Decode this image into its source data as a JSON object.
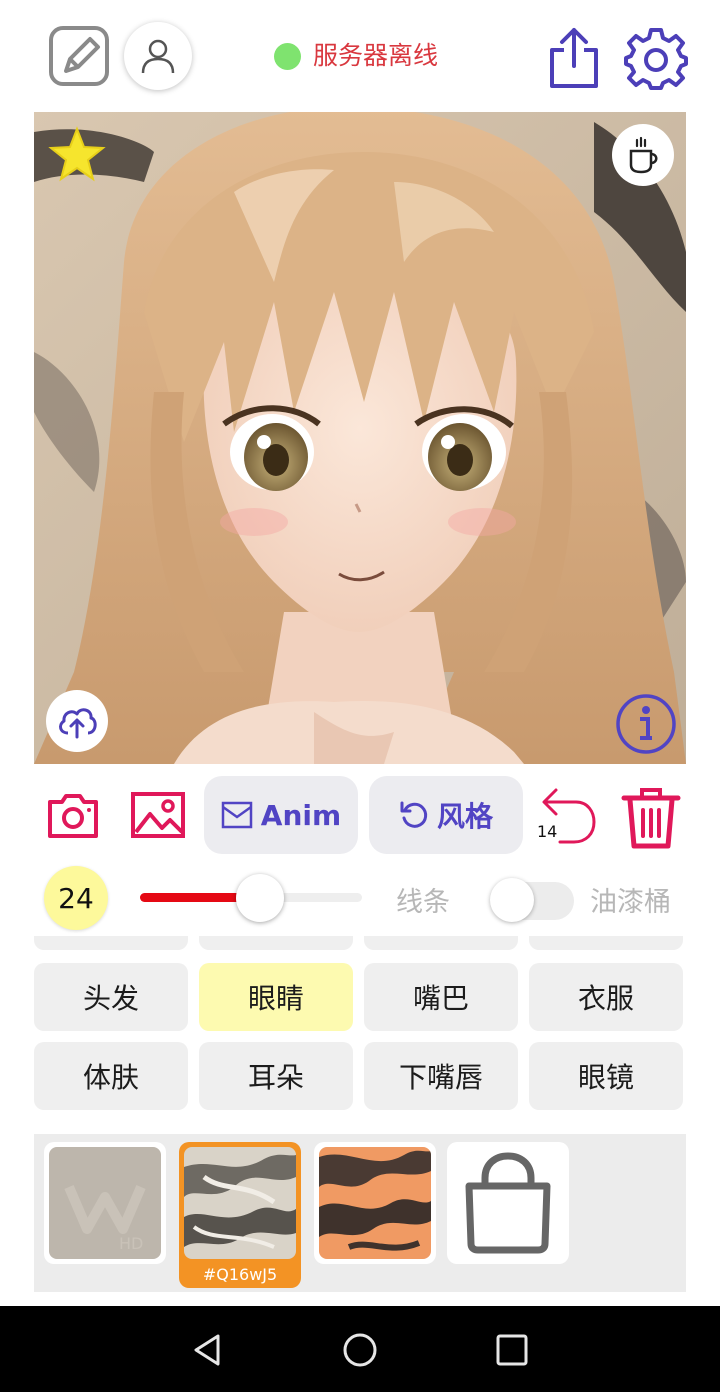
{
  "header": {
    "status_text": "服务器离线",
    "status_color": "#7fe36f",
    "icons": [
      "sketch-pen-icon",
      "user-icon",
      "share-icon",
      "gear-icon"
    ]
  },
  "canvas": {
    "favorite_icon": "star-icon",
    "coffee_icon": "coffee-icon",
    "upload_icon": "cloud-upload-icon",
    "info_icon": "info-icon"
  },
  "toolbar": {
    "camera_icon": "camera-icon",
    "gallery_icon": "image-icon",
    "anim_label": "Anim",
    "style_label": "风格",
    "undo_count": "14",
    "trash_icon": "trash-icon"
  },
  "brush": {
    "size": "24",
    "size_fraction": 0.54,
    "mode_line": "线条",
    "mode_bucket": "油漆桶",
    "bucket_enabled": false
  },
  "labels": {
    "row1": [
      "头发",
      "眼睛",
      "嘴巴",
      "衣服"
    ],
    "row2": [
      "体肤",
      "耳朵",
      "下嘴唇",
      "眼镜"
    ],
    "active": "眼睛"
  },
  "styles": {
    "selected_code": "#Q16wJ5",
    "accent": "#f39324"
  },
  "colors": {
    "brand": "#5144c4",
    "danger": "#e0185a",
    "status_text": "#d9383f"
  }
}
